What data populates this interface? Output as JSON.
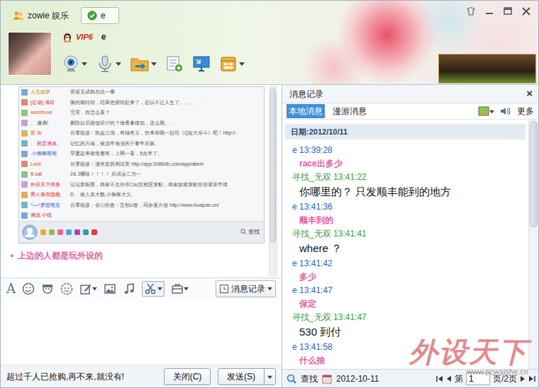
{
  "window": {
    "tabs": [
      {
        "label": "zowie 娱乐",
        "kind": "group",
        "selected": false
      },
      {
        "label": "e",
        "kind": "contact",
        "selected": true
      }
    ]
  },
  "contact": {
    "vip": "VIP6",
    "name": "e"
  },
  "chat": {
    "shared_screenshot": {
      "rows": [
        {
          "name": "人生如梦",
          "message": "谁最见成熟在此一章",
          "color": "#c08000"
        },
        {
          "name": "[逗场] 薄荷",
          "message": "微的期待得，结果把握得起来了，还以不让人生了。。。。。",
          "color": "#e02020"
        },
        {
          "name": "weshbowl",
          "message": "元芳，你怎么看？",
          "color": "#e06000"
        },
        {
          "name": "、 潇洒!",
          "message": "删除以后路便设计的？做番事建动，这么我。。",
          "color": "#333333"
        },
        {
          "name": "新 宸",
          "message": "分享链接：热血江湖，有钱有义，快来和我一起玩《Q宠大乐斗》吧！http://",
          "color": "#e06000"
        },
        {
          "name": "、 然富滴派。",
          "message": "记忆的方城，被流年淹没的千事年后家。",
          "color": "#d02080"
        },
        {
          "name": ".小御御善雨",
          "message": "早重起来都觉着有，上网一看，5点半了。",
          "color": "#2050c0"
        },
        {
          "name": "Leek",
          "message": "分享链接：漫性篮西测试安 http://app.0086dh.com/app/dkeni",
          "color": "#e06000"
        },
        {
          "name": "S cat",
          "message": "2& 2哪咏！！！！ 后成会二为一",
          "color": "#c02020"
        },
        {
          "name": "外设天下商务",
          "message": "论坛新板面，商家不允许在Cac交相区发帖，商家如需发帖宣传需要申请",
          "color": "#e02020"
        },
        {
          "name": "男人表在隐蠢。",
          "message": "D、 敢人真大数,小胸客大欠.",
          "color": "#e02020"
        },
        {
          "name": "^—^梦想电竞",
          "message": "分享链接：金山快盘：告别U盘，同步更方便 http://www.kuaipan.cn/",
          "color": "#2050c0"
        },
        {
          "name": "潮流.小优",
          "color": "#c02020"
        }
      ],
      "search": "查找"
    },
    "messages": [
      {
        "bullet": "•",
        "text": "上边的人都是玩外设的"
      }
    ]
  },
  "input_toolbar": {
    "font_button": "A",
    "history_button": "消息记录"
  },
  "footer": {
    "ad": "超过千人已抢购,再不来,就没有!",
    "buttons": [
      {
        "label": "关闭(C)",
        "kind": "plain"
      },
      {
        "label": "发送(S)",
        "kind": "split"
      }
    ]
  },
  "history": {
    "title": "消息记录",
    "close": "×",
    "tabs": [
      {
        "label": "本地消息",
        "selected": true
      },
      {
        "label": "漫游消息",
        "selected": false
      }
    ],
    "more": "更多",
    "date": "日期:2012/10/11",
    "entries": [
      {
        "sender": "e",
        "time": "13:39:28",
        "text": "race出多少",
        "kind": "self"
      },
      {
        "sender": "寻找_无双",
        "time": "13:41:22",
        "text": "你哪里的？ 只发顺丰能到的地方",
        "kind": "peer"
      },
      {
        "sender": "e",
        "time": "13:41:36",
        "text": "顺丰到的",
        "kind": "self"
      },
      {
        "sender": "寻找_无双",
        "time": "13:41:41",
        "text": "where ？",
        "kind": "peer"
      },
      {
        "sender": "e",
        "time": "13:41:42",
        "text": "多少",
        "kind": "self"
      },
      {
        "sender": "e",
        "time": "13:41:47",
        "text": "保定",
        "kind": "self"
      },
      {
        "sender": "寻找_无双",
        "time": "13:41:47",
        "text": "530 到付",
        "kind": "peer"
      },
      {
        "sender": "e",
        "time": "13:41:58",
        "text": "什么抽",
        "kind": "self"
      }
    ],
    "footer": {
      "search": "查找",
      "date": "2012-10-11",
      "page_prefix": "第",
      "page": "1",
      "page_suffix": "页/2页"
    }
  },
  "watermark": {
    "brand": "外设天下",
    "url": "www.pcwaishe.cn"
  }
}
